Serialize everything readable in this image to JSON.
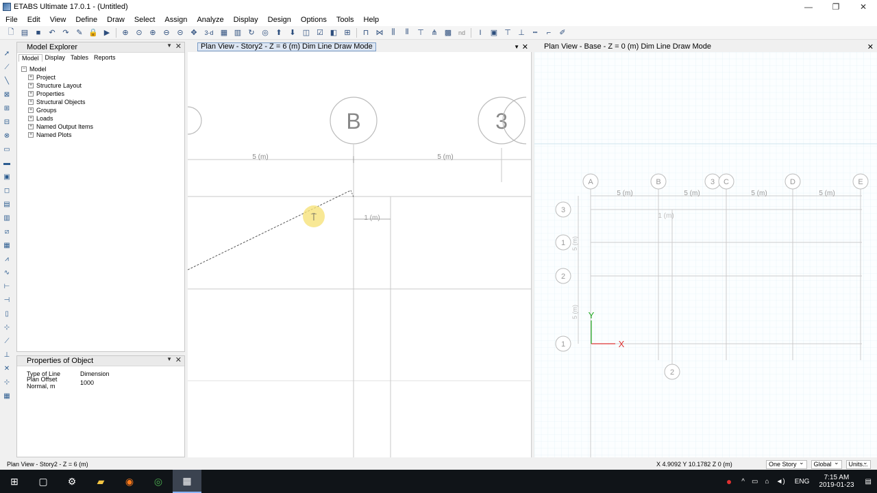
{
  "window": {
    "title": "ETABS Ultimate 17.0.1 - (Untitled)"
  },
  "menu": [
    "File",
    "Edit",
    "View",
    "Define",
    "Draw",
    "Select",
    "Assign",
    "Analyze",
    "Display",
    "Design",
    "Options",
    "Tools",
    "Help"
  ],
  "toolbar": {
    "tb_3d": "3-d",
    "tb_nd": "nd"
  },
  "model_explorer": {
    "title": "Model Explorer",
    "tabs": [
      "Model",
      "Display",
      "Tables",
      "Reports"
    ],
    "root": "Model",
    "items": [
      "Project",
      "Structure Layout",
      "Properties",
      "Structural Objects",
      "Groups",
      "Loads",
      "Named Output Items",
      "Named Plots"
    ]
  },
  "properties": {
    "title": "Properties of Object",
    "rows": [
      {
        "key": "Type of Line",
        "value": "Dimension"
      },
      {
        "key": "Plan Offset Normal, m",
        "value": "1000"
      }
    ]
  },
  "view1": {
    "title": "Plan View - Story2 - Z = 6 (m)  Dim Line Draw Mode",
    "bubble_b": "B",
    "bubble_3": "3",
    "dim_left": "5 (m)",
    "dim_right": "5 (m)",
    "dim_small": "1 (m)"
  },
  "view2": {
    "title": "Plan View - Base - Z = 0 (m)  Dim Line Draw Mode",
    "top_bubbles": [
      "A",
      "B",
      "3",
      "C",
      "D",
      "E"
    ],
    "left_bubbles": [
      "3",
      "1",
      "2",
      "1"
    ],
    "bottom_bubble": "2",
    "dims": [
      "5 (m)",
      "5 (m)",
      "5 (m)",
      "5 (m)"
    ],
    "dim_small": "1 (m)",
    "vertical_dims": [
      "5 (m)",
      "5 (m)"
    ],
    "axis_x": "X",
    "axis_y": "Y"
  },
  "status": {
    "left": "Plan View - Story2 - Z = 6 (m)",
    "coords": "X 4.9092  Y 10.1782  Z 0 (m)",
    "story": "One Story",
    "coord_sys": "Global",
    "units": "Units..."
  },
  "tray": {
    "lang": "ENG",
    "time": "7:15 AM",
    "date": "2019-01-23"
  }
}
